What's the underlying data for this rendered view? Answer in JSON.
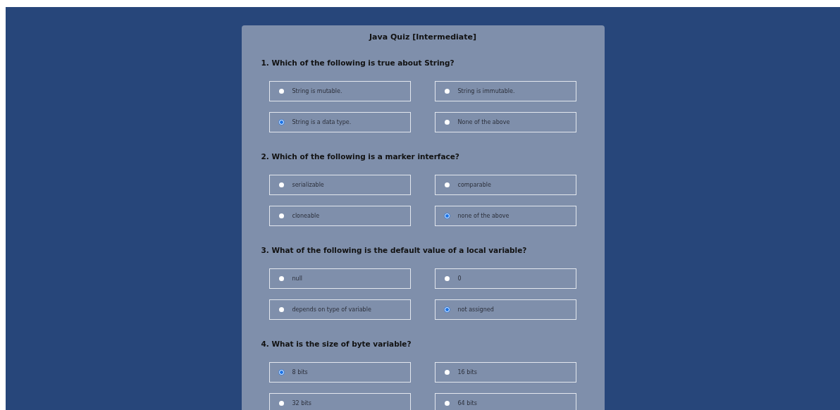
{
  "title": "Java Quiz [Intermediate]",
  "questions": [
    {
      "text": "1. Which of the following is true about String?",
      "options": [
        {
          "label": "String is mutable.",
          "selected": false
        },
        {
          "label": "String is immutable.",
          "selected": false
        },
        {
          "label": "String is a data type.",
          "selected": true
        },
        {
          "label": "None of the above",
          "selected": false
        }
      ]
    },
    {
      "text": "2. Which of the following is a marker interface?",
      "options": [
        {
          "label": "serializable",
          "selected": false
        },
        {
          "label": "comparable",
          "selected": false
        },
        {
          "label": "cloneable",
          "selected": false
        },
        {
          "label": "none of the above",
          "selected": true
        }
      ]
    },
    {
      "text": "3. What of the following is the default value of a local variable?",
      "options": [
        {
          "label": "null",
          "selected": false
        },
        {
          "label": "0",
          "selected": false
        },
        {
          "label": "depends on type of variable",
          "selected": false
        },
        {
          "label": "not assigned",
          "selected": true
        }
      ]
    },
    {
      "text": "4. What is the size of byte variable?",
      "options": [
        {
          "label": "8 bits",
          "selected": true
        },
        {
          "label": "16 bits",
          "selected": false
        },
        {
          "label": "32 bits",
          "selected": false
        },
        {
          "label": "64 bits",
          "selected": false
        }
      ]
    }
  ]
}
